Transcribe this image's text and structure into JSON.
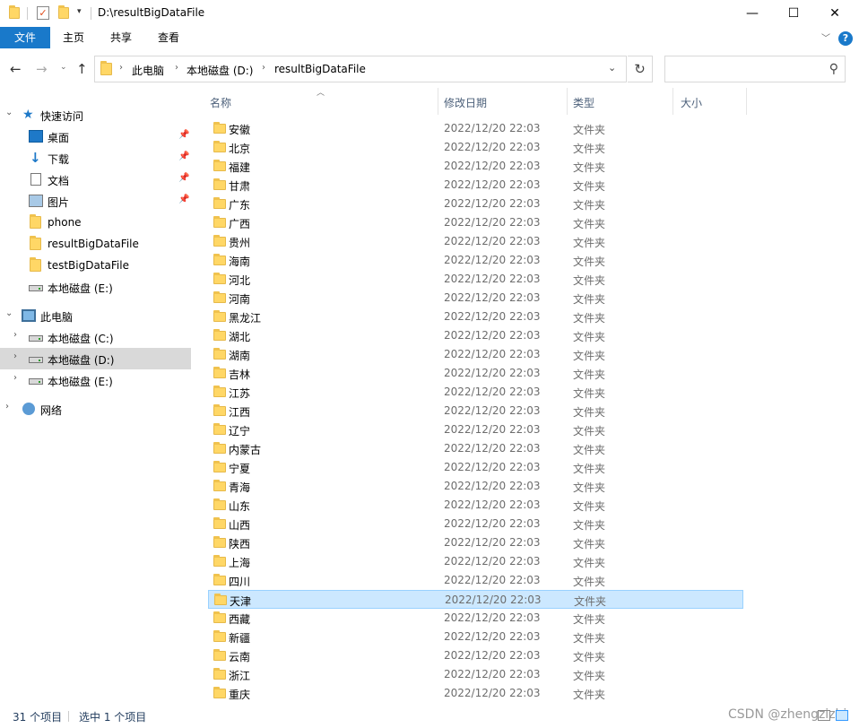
{
  "window": {
    "title": "D:\\resultBigDataFile",
    "minimize_glyph": "—",
    "maximize_glyph": "☐",
    "close_glyph": "✕"
  },
  "ribbon": {
    "tabs": [
      "文件",
      "主页",
      "共享",
      "查看"
    ],
    "help_label": "?"
  },
  "address": {
    "crumbs": [
      "此电脑",
      "本地磁盘 (D:)",
      "resultBigDataFile"
    ],
    "search_placeholder": ""
  },
  "nav": {
    "quick_access": "快速访问",
    "quick_items": [
      {
        "label": "桌面",
        "icon": "desktop-icon",
        "pinned": true
      },
      {
        "label": "下载",
        "icon": "download-icon",
        "pinned": true
      },
      {
        "label": "文档",
        "icon": "document-icon",
        "pinned": true
      },
      {
        "label": "图片",
        "icon": "pictures-icon",
        "pinned": true
      },
      {
        "label": "phone",
        "icon": "folder-icon",
        "pinned": false
      },
      {
        "label": "resultBigDataFile",
        "icon": "folder-icon",
        "pinned": false
      },
      {
        "label": "testBigDataFile",
        "icon": "folder-icon",
        "pinned": false
      },
      {
        "label": "本地磁盘 (E:)",
        "icon": "drive-icon",
        "pinned": false
      }
    ],
    "this_pc": "此电脑",
    "pc_items": [
      {
        "label": "本地磁盘 (C:)",
        "selected": false
      },
      {
        "label": "本地磁盘 (D:)",
        "selected": true
      },
      {
        "label": "本地磁盘 (E:)",
        "selected": false
      }
    ],
    "network": "网络"
  },
  "columns": {
    "name": "名称",
    "date": "修改日期",
    "type": "类型",
    "size": "大小"
  },
  "files": [
    {
      "name": "安徽",
      "date": "2022/12/20 22:03",
      "type": "文件夹"
    },
    {
      "name": "北京",
      "date": "2022/12/20 22:03",
      "type": "文件夹"
    },
    {
      "name": "福建",
      "date": "2022/12/20 22:03",
      "type": "文件夹"
    },
    {
      "name": "甘肃",
      "date": "2022/12/20 22:03",
      "type": "文件夹"
    },
    {
      "name": "广东",
      "date": "2022/12/20 22:03",
      "type": "文件夹"
    },
    {
      "name": "广西",
      "date": "2022/12/20 22:03",
      "type": "文件夹"
    },
    {
      "name": "贵州",
      "date": "2022/12/20 22:03",
      "type": "文件夹"
    },
    {
      "name": "海南",
      "date": "2022/12/20 22:03",
      "type": "文件夹"
    },
    {
      "name": "河北",
      "date": "2022/12/20 22:03",
      "type": "文件夹"
    },
    {
      "name": "河南",
      "date": "2022/12/20 22:03",
      "type": "文件夹"
    },
    {
      "name": "黑龙江",
      "date": "2022/12/20 22:03",
      "type": "文件夹"
    },
    {
      "name": "湖北",
      "date": "2022/12/20 22:03",
      "type": "文件夹"
    },
    {
      "name": "湖南",
      "date": "2022/12/20 22:03",
      "type": "文件夹"
    },
    {
      "name": "吉林",
      "date": "2022/12/20 22:03",
      "type": "文件夹"
    },
    {
      "name": "江苏",
      "date": "2022/12/20 22:03",
      "type": "文件夹"
    },
    {
      "name": "江西",
      "date": "2022/12/20 22:03",
      "type": "文件夹"
    },
    {
      "name": "辽宁",
      "date": "2022/12/20 22:03",
      "type": "文件夹"
    },
    {
      "name": "内蒙古",
      "date": "2022/12/20 22:03",
      "type": "文件夹"
    },
    {
      "name": "宁夏",
      "date": "2022/12/20 22:03",
      "type": "文件夹"
    },
    {
      "name": "青海",
      "date": "2022/12/20 22:03",
      "type": "文件夹"
    },
    {
      "name": "山东",
      "date": "2022/12/20 22:03",
      "type": "文件夹"
    },
    {
      "name": "山西",
      "date": "2022/12/20 22:03",
      "type": "文件夹"
    },
    {
      "name": "陕西",
      "date": "2022/12/20 22:03",
      "type": "文件夹"
    },
    {
      "name": "上海",
      "date": "2022/12/20 22:03",
      "type": "文件夹"
    },
    {
      "name": "四川",
      "date": "2022/12/20 22:03",
      "type": "文件夹"
    },
    {
      "name": "天津",
      "date": "2022/12/20 22:03",
      "type": "文件夹",
      "selected": true
    },
    {
      "name": "西藏",
      "date": "2022/12/20 22:03",
      "type": "文件夹"
    },
    {
      "name": "新疆",
      "date": "2022/12/20 22:03",
      "type": "文件夹"
    },
    {
      "name": "云南",
      "date": "2022/12/20 22:03",
      "type": "文件夹"
    },
    {
      "name": "浙江",
      "date": "2022/12/20 22:03",
      "type": "文件夹"
    },
    {
      "name": "重庆",
      "date": "2022/12/20 22:03",
      "type": "文件夹"
    }
  ],
  "status": {
    "item_count": "31 个项目",
    "selected_count": "选中 1 个项目",
    "watermark": "CSDN @zhengzizhi"
  },
  "colors": {
    "accent": "#1979ca",
    "selection": "#cce8ff",
    "folder": "#ffd766"
  }
}
